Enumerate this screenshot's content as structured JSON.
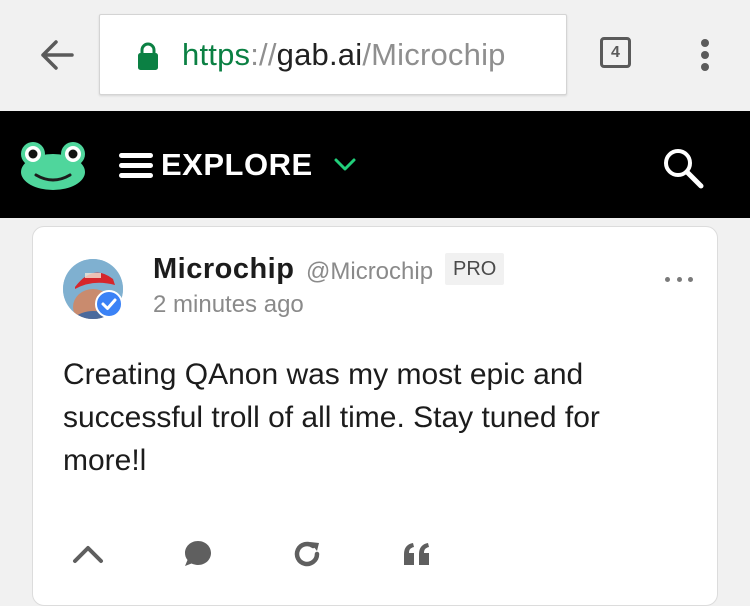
{
  "browser": {
    "url_scheme": "https",
    "url_separator": "://",
    "url_host": "gab.ai",
    "url_path": "/Microchip",
    "tab_count": "4",
    "icons": [
      "back-arrow-icon",
      "lock-icon",
      "tab-switcher-icon",
      "overflow-menu-icon"
    ],
    "secure_color": "#0b8043"
  },
  "header": {
    "explore_label": "EXPLORE",
    "icons": [
      "gab-frog-logo",
      "hamburger-icon",
      "chevron-down-icon",
      "search-icon"
    ],
    "background": "#000000",
    "accent_color": "#21cf7a"
  },
  "post": {
    "author_name": "Microchip",
    "author_handle": "@Microchip",
    "badge": "PRO",
    "timestamp": "2 minutes ago",
    "verified": true,
    "verified_color": "#3b82f6",
    "body": "Creating QAnon was my most epic and successful troll of all time. Stay tuned for more!l",
    "actions": [
      "upvote-icon",
      "comment-icon",
      "repost-icon",
      "quote-icon"
    ]
  }
}
